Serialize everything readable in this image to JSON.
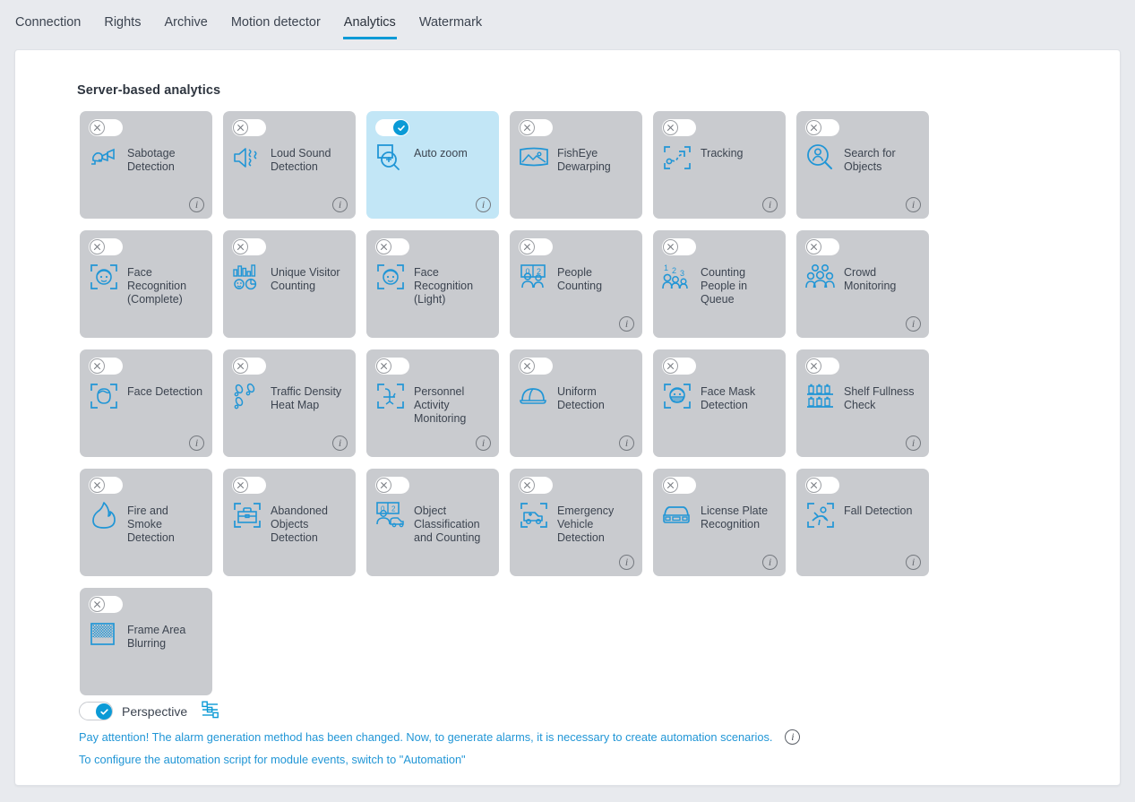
{
  "tabs": [
    {
      "label": "Connection",
      "active": false
    },
    {
      "label": "Rights",
      "active": false
    },
    {
      "label": "Archive",
      "active": false
    },
    {
      "label": "Motion detector",
      "active": false
    },
    {
      "label": "Analytics",
      "active": true
    },
    {
      "label": "Watermark",
      "active": false
    }
  ],
  "section": {
    "title": "Server-based analytics"
  },
  "colors": {
    "accent": "#0b9ad6",
    "link": "#2196d6",
    "card_bg": "#c9cbcf",
    "card_active_bg": "#c2e6f6",
    "page_bg": "#e8eaee",
    "panel_bg": "#ffffff",
    "text": "#3c4450"
  },
  "cards": [
    {
      "label": "Sabotage Detection",
      "icon": "sabotage-camera-icon",
      "enabled": false,
      "has_info": true
    },
    {
      "label": "Loud Sound Detection",
      "icon": "loud-speaker-icon",
      "enabled": false,
      "has_info": true
    },
    {
      "label": "Auto zoom",
      "icon": "auto-zoom-magnifier-icon",
      "enabled": true,
      "has_info": true
    },
    {
      "label": "FishEye Dewarping",
      "icon": "fisheye-panorama-icon",
      "enabled": false,
      "has_info": false
    },
    {
      "label": "Tracking",
      "icon": "tracking-path-icon",
      "enabled": false,
      "has_info": true
    },
    {
      "label": "Search for Objects",
      "icon": "search-person-icon",
      "enabled": false,
      "has_info": true
    },
    {
      "label": "Face Recognition (Complete)",
      "icon": "face-recognition-icon",
      "enabled": false,
      "has_info": false
    },
    {
      "label": "Unique Visitor Counting",
      "icon": "visitor-chart-icon",
      "enabled": false,
      "has_info": false
    },
    {
      "label": "Face Recognition (Light)",
      "icon": "face-recognition-icon",
      "enabled": false,
      "has_info": false
    },
    {
      "label": "People Counting",
      "icon": "people-counting-icon",
      "enabled": false,
      "has_info": true
    },
    {
      "label": "Counting People in Queue",
      "icon": "queue-counting-icon",
      "enabled": false,
      "has_info": false
    },
    {
      "label": "Crowd Monitoring",
      "icon": "crowd-icon",
      "enabled": false,
      "has_info": true
    },
    {
      "label": "Face Detection",
      "icon": "face-detection-icon",
      "enabled": false,
      "has_info": true
    },
    {
      "label": "Traffic Density Heat Map",
      "icon": "footprints-icon",
      "enabled": false,
      "has_info": true
    },
    {
      "label": "Personnel Activity Monitoring",
      "icon": "chair-icon",
      "enabled": false,
      "has_info": true
    },
    {
      "label": "Uniform Detection",
      "icon": "helmet-icon",
      "enabled": false,
      "has_info": true
    },
    {
      "label": "Face Mask Detection",
      "icon": "face-mask-icon",
      "enabled": false,
      "has_info": false
    },
    {
      "label": "Shelf Fullness Check",
      "icon": "shelf-icon",
      "enabled": false,
      "has_info": true
    },
    {
      "label": "Fire and Smoke Detection",
      "icon": "flame-icon",
      "enabled": false,
      "has_info": false
    },
    {
      "label": "Abandoned Objects Detection",
      "icon": "briefcase-icon",
      "enabled": false,
      "has_info": false
    },
    {
      "label": "Object Classification and Counting",
      "icon": "object-classification-icon",
      "enabled": false,
      "has_info": false
    },
    {
      "label": "Emergency Vehicle Detection",
      "icon": "ambulance-icon",
      "enabled": false,
      "has_info": true
    },
    {
      "label": "License Plate Recognition",
      "icon": "car-plate-icon",
      "enabled": false,
      "has_info": true
    },
    {
      "label": "Fall Detection",
      "icon": "fall-person-icon",
      "enabled": false,
      "has_info": true
    },
    {
      "label": "Frame Area Blurring",
      "icon": "blur-area-icon",
      "enabled": false,
      "has_info": false
    }
  ],
  "perspective": {
    "label": "Perspective",
    "enabled": true,
    "settings_icon": "sliders-icon"
  },
  "notes": [
    {
      "text": "Pay attention! The alarm generation method has been changed. Now, to generate alarms, it is necessary to create automation scenarios.",
      "has_info": true
    },
    {
      "text": "To configure the automation script for module events, switch to \"Automation\"",
      "has_info": false
    }
  ]
}
